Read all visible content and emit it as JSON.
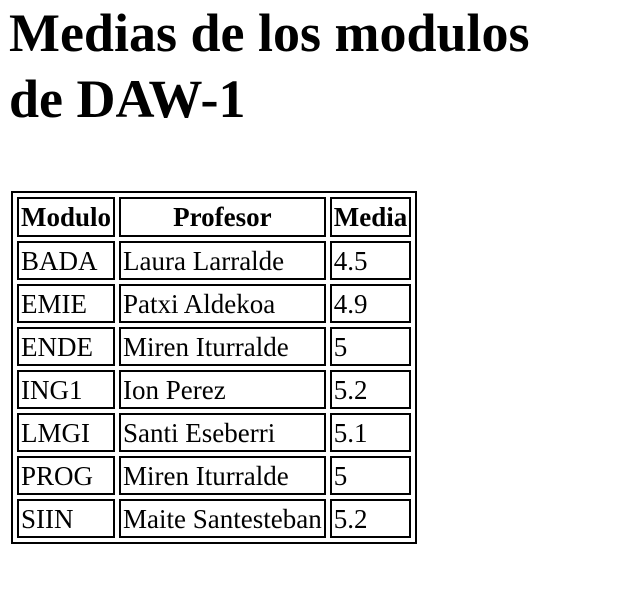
{
  "heading": {
    "line1": "Medias de los modulos",
    "line2": "de DAW-1"
  },
  "table": {
    "headers": {
      "modulo": "Modulo",
      "profesor": "Profesor",
      "media": "Media"
    },
    "rows": [
      {
        "modulo": "BADA",
        "profesor": "Laura Larralde",
        "media": "4.5"
      },
      {
        "modulo": "EMIE",
        "profesor": "Patxi Aldekoa",
        "media": "4.9"
      },
      {
        "modulo": "ENDE",
        "profesor": "Miren Iturralde",
        "media": "5"
      },
      {
        "modulo": "ING1",
        "profesor": "Ion Perez",
        "media": "5.2"
      },
      {
        "modulo": "LMGI",
        "profesor": "Santi Eseberri",
        "media": "5.1"
      },
      {
        "modulo": "PROG",
        "profesor": "Miren Iturralde",
        "media": "5"
      },
      {
        "modulo": "SIIN",
        "profesor": "Maite Santesteban",
        "media": "5.2"
      }
    ]
  }
}
